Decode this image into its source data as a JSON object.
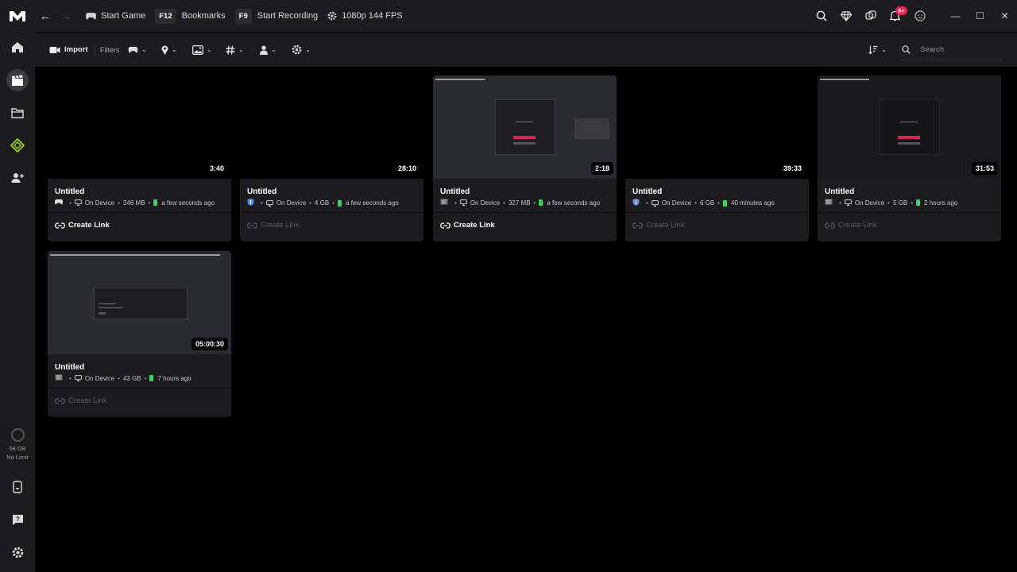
{
  "titlebar": {
    "start_game": "Start Game",
    "bookmarks_key": "F12",
    "bookmarks": "Bookmarks",
    "record_key": "F9",
    "start_recording": "Start Recording",
    "quality": "1080p 144 FPS",
    "notification_count": "9+"
  },
  "toolbar": {
    "import": "Import",
    "filters": "Filters",
    "search_placeholder": "Search"
  },
  "sidebar": {
    "storage_size": "58 GB",
    "storage_limit": "No Limit"
  },
  "clips": [
    {
      "title": "Untitled",
      "duration": "3:40",
      "location": "On Device",
      "size": "246 MB",
      "time": "a few seconds ago",
      "link": "Create Link",
      "link_enabled": true,
      "game_icon": "gamepad-icon",
      "thumb": "black"
    },
    {
      "title": "Untitled",
      "duration": "28:10",
      "location": "On Device",
      "size": "4 GB",
      "time": "a few seconds ago",
      "link": "Create Link",
      "link_enabled": false,
      "game_icon": "shield-game-icon",
      "thumb": "black"
    },
    {
      "title": "Untitled",
      "duration": "2:18",
      "location": "On Device",
      "size": "327 MB",
      "time": "a few seconds ago",
      "link": "Create Link",
      "link_enabled": true,
      "game_icon": "app-icon",
      "thumb": "screen"
    },
    {
      "title": "Untitled",
      "duration": "39:33",
      "location": "On Device",
      "size": "6 GB",
      "time": "40 minutes ago",
      "link": "Create Link",
      "link_enabled": false,
      "game_icon": "shield-game-icon",
      "thumb": "black"
    },
    {
      "title": "Untitled",
      "duration": "31:53",
      "location": "On Device",
      "size": "5 GB",
      "time": "2 hours ago",
      "link": "Create Link",
      "link_enabled": false,
      "game_icon": "app-icon",
      "thumb": "screen-dark"
    },
    {
      "title": "Untitled",
      "duration": "05:00:30",
      "location": "On Device",
      "size": "43 GB",
      "time": "7 hours ago",
      "link": "Create Link",
      "link_enabled": false,
      "game_icon": "app-icon",
      "thumb": "screen"
    }
  ],
  "colors": {
    "accent_green": "#3ad163",
    "sidebar_active_icon": "#9ad21e",
    "badge": "#e5245a"
  }
}
